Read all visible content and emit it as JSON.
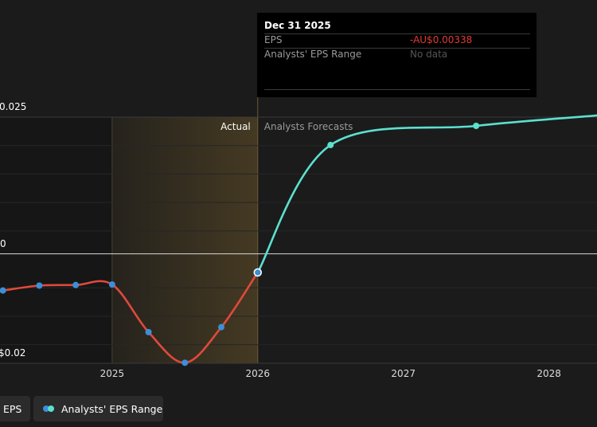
{
  "chart_data": {
    "type": "line",
    "y_tick_labels": [
      "0.025",
      "0",
      "$0.02"
    ],
    "x_tick_labels": [
      "2025",
      "2026",
      "2027",
      "2028"
    ],
    "region_labels": {
      "actual": "Actual",
      "forecast": "Analysts Forecasts"
    },
    "series": [
      {
        "name": "EPS",
        "color": "#e0493c",
        "x": [
          2024.25,
          2024.5,
          2024.75,
          2025.0,
          2025.25,
          2025.5,
          2025.75,
          2026.0
        ],
        "y": [
          -0.0067,
          -0.0058,
          -0.0057,
          -0.0056,
          -0.0143,
          -0.0199,
          -0.0134,
          -0.0034
        ]
      },
      {
        "name": "Analysts' EPS Range",
        "color": "#5ce0cf",
        "x": [
          2026.0,
          2026.5,
          2027.5,
          2028.33
        ],
        "y": [
          -0.0034,
          0.0199,
          0.0234,
          0.0253
        ]
      }
    ],
    "xlim": [
      2024.23,
      2028.33
    ],
    "ylim": [
      -0.02,
      0.025
    ],
    "grid": true
  },
  "tooltip": {
    "date": "Dec 31 2025",
    "eps_label": "EPS",
    "eps_value": "-AU$0.00338",
    "range_label": "Analysts' EPS Range",
    "range_value": "No data"
  },
  "legend": {
    "eps_label": "EPS",
    "range_label": "Analysts' EPS Range"
  },
  "colors": {
    "eps_line": "#e0493c",
    "forecast_line": "#5ce0cf",
    "point": "#3b8fd9",
    "negative_value": "#e53935",
    "highlight": "#c89a3a"
  }
}
